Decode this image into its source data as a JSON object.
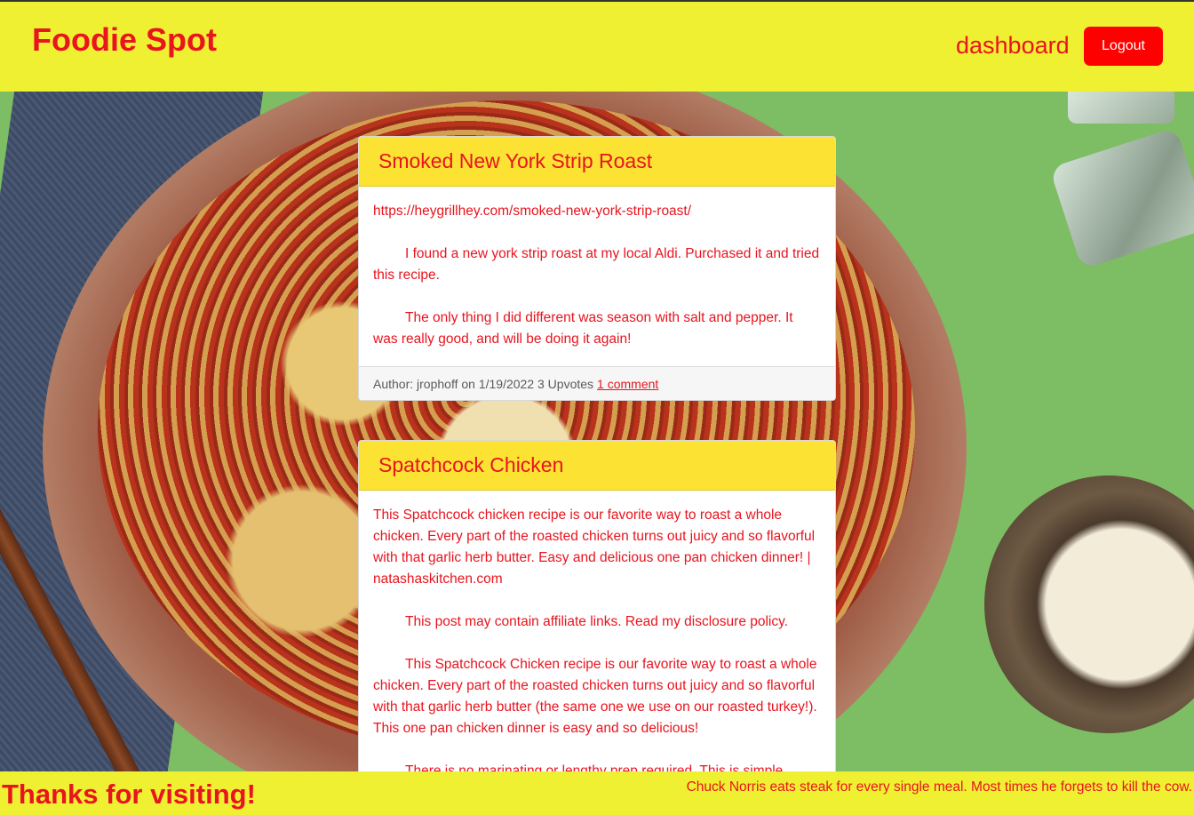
{
  "header": {
    "brand": "Foodie Spot",
    "nav_dashboard": "dashboard",
    "logout_label": "Logout"
  },
  "posts": [
    {
      "title": "Smoked New York Strip Roast",
      "paragraphs": [
        "https://heygrillhey.com/smoked-new-york-strip-roast/",
        "I found a new york strip roast at my local Aldi. Purchased it and tried this recipe.",
        "The only thing I did different was season with salt and pepper. It was really good, and will be doing it again!"
      ],
      "meta": "Author: jrophoff on 1/19/2022 3 Upvotes",
      "comments_link": "1 comment"
    },
    {
      "title": "Spatchcock Chicken",
      "paragraphs": [
        "This Spatchcock chicken recipe is our favorite way to roast a whole chicken. Every part of the roasted chicken turns out juicy and so flavorful with that garlic herb butter. Easy and delicious one pan chicken dinner! | natashaskitchen.com",
        "This post may contain affiliate links. Read my disclosure policy.",
        "This Spatchcock Chicken recipe is our favorite way to roast a whole chicken. Every part of the roasted chicken turns out juicy and so flavorful with that garlic herb butter (the same one we use on our roasted turkey!). This one pan chicken dinner is easy and so delicious!",
        "There is no marinating or lengthy prep required. This is simple"
      ]
    }
  ],
  "footer": {
    "thanks": "Thanks for visiting!",
    "joke": "Chuck Norris eats steak for every single meal. Most times he forgets to kill the cow."
  },
  "colors": {
    "header_bg": "#f0f032",
    "accent_red": "#e8141e",
    "card_header_bg": "#fbe233",
    "logout_bg": "#ff0000"
  }
}
